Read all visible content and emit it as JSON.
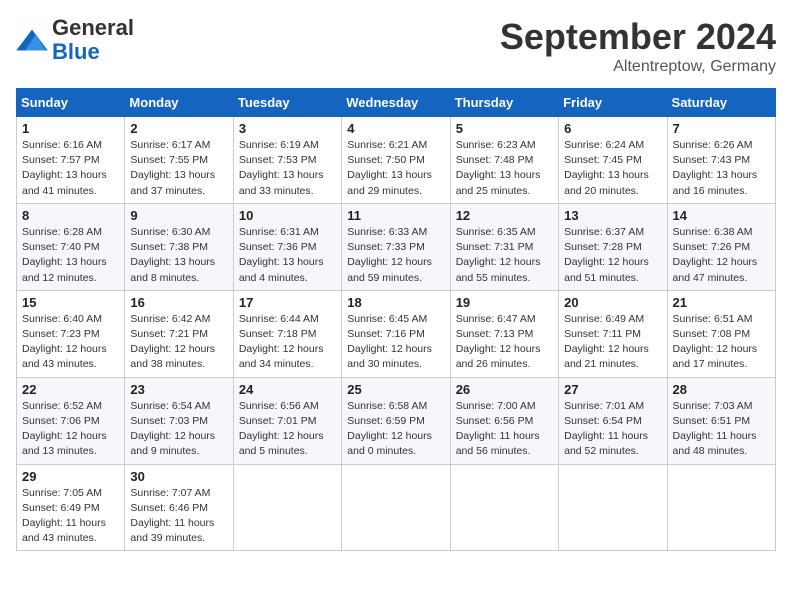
{
  "header": {
    "logo_general": "General",
    "logo_blue": "Blue",
    "month_title": "September 2024",
    "subtitle": "Altentreptow, Germany"
  },
  "days_of_week": [
    "Sunday",
    "Monday",
    "Tuesday",
    "Wednesday",
    "Thursday",
    "Friday",
    "Saturday"
  ],
  "weeks": [
    [
      {
        "day": "1",
        "info": "Sunrise: 6:16 AM\nSunset: 7:57 PM\nDaylight: 13 hours\nand 41 minutes."
      },
      {
        "day": "2",
        "info": "Sunrise: 6:17 AM\nSunset: 7:55 PM\nDaylight: 13 hours\nand 37 minutes."
      },
      {
        "day": "3",
        "info": "Sunrise: 6:19 AM\nSunset: 7:53 PM\nDaylight: 13 hours\nand 33 minutes."
      },
      {
        "day": "4",
        "info": "Sunrise: 6:21 AM\nSunset: 7:50 PM\nDaylight: 13 hours\nand 29 minutes."
      },
      {
        "day": "5",
        "info": "Sunrise: 6:23 AM\nSunset: 7:48 PM\nDaylight: 13 hours\nand 25 minutes."
      },
      {
        "day": "6",
        "info": "Sunrise: 6:24 AM\nSunset: 7:45 PM\nDaylight: 13 hours\nand 20 minutes."
      },
      {
        "day": "7",
        "info": "Sunrise: 6:26 AM\nSunset: 7:43 PM\nDaylight: 13 hours\nand 16 minutes."
      }
    ],
    [
      {
        "day": "8",
        "info": "Sunrise: 6:28 AM\nSunset: 7:40 PM\nDaylight: 13 hours\nand 12 minutes."
      },
      {
        "day": "9",
        "info": "Sunrise: 6:30 AM\nSunset: 7:38 PM\nDaylight: 13 hours\nand 8 minutes."
      },
      {
        "day": "10",
        "info": "Sunrise: 6:31 AM\nSunset: 7:36 PM\nDaylight: 13 hours\nand 4 minutes."
      },
      {
        "day": "11",
        "info": "Sunrise: 6:33 AM\nSunset: 7:33 PM\nDaylight: 12 hours\nand 59 minutes."
      },
      {
        "day": "12",
        "info": "Sunrise: 6:35 AM\nSunset: 7:31 PM\nDaylight: 12 hours\nand 55 minutes."
      },
      {
        "day": "13",
        "info": "Sunrise: 6:37 AM\nSunset: 7:28 PM\nDaylight: 12 hours\nand 51 minutes."
      },
      {
        "day": "14",
        "info": "Sunrise: 6:38 AM\nSunset: 7:26 PM\nDaylight: 12 hours\nand 47 minutes."
      }
    ],
    [
      {
        "day": "15",
        "info": "Sunrise: 6:40 AM\nSunset: 7:23 PM\nDaylight: 12 hours\nand 43 minutes."
      },
      {
        "day": "16",
        "info": "Sunrise: 6:42 AM\nSunset: 7:21 PM\nDaylight: 12 hours\nand 38 minutes."
      },
      {
        "day": "17",
        "info": "Sunrise: 6:44 AM\nSunset: 7:18 PM\nDaylight: 12 hours\nand 34 minutes."
      },
      {
        "day": "18",
        "info": "Sunrise: 6:45 AM\nSunset: 7:16 PM\nDaylight: 12 hours\nand 30 minutes."
      },
      {
        "day": "19",
        "info": "Sunrise: 6:47 AM\nSunset: 7:13 PM\nDaylight: 12 hours\nand 26 minutes."
      },
      {
        "day": "20",
        "info": "Sunrise: 6:49 AM\nSunset: 7:11 PM\nDaylight: 12 hours\nand 21 minutes."
      },
      {
        "day": "21",
        "info": "Sunrise: 6:51 AM\nSunset: 7:08 PM\nDaylight: 12 hours\nand 17 minutes."
      }
    ],
    [
      {
        "day": "22",
        "info": "Sunrise: 6:52 AM\nSunset: 7:06 PM\nDaylight: 12 hours\nand 13 minutes."
      },
      {
        "day": "23",
        "info": "Sunrise: 6:54 AM\nSunset: 7:03 PM\nDaylight: 12 hours\nand 9 minutes."
      },
      {
        "day": "24",
        "info": "Sunrise: 6:56 AM\nSunset: 7:01 PM\nDaylight: 12 hours\nand 5 minutes."
      },
      {
        "day": "25",
        "info": "Sunrise: 6:58 AM\nSunset: 6:59 PM\nDaylight: 12 hours\nand 0 minutes."
      },
      {
        "day": "26",
        "info": "Sunrise: 7:00 AM\nSunset: 6:56 PM\nDaylight: 11 hours\nand 56 minutes."
      },
      {
        "day": "27",
        "info": "Sunrise: 7:01 AM\nSunset: 6:54 PM\nDaylight: 11 hours\nand 52 minutes."
      },
      {
        "day": "28",
        "info": "Sunrise: 7:03 AM\nSunset: 6:51 PM\nDaylight: 11 hours\nand 48 minutes."
      }
    ],
    [
      {
        "day": "29",
        "info": "Sunrise: 7:05 AM\nSunset: 6:49 PM\nDaylight: 11 hours\nand 43 minutes."
      },
      {
        "day": "30",
        "info": "Sunrise: 7:07 AM\nSunset: 6:46 PM\nDaylight: 11 hours\nand 39 minutes."
      },
      {
        "day": "",
        "info": ""
      },
      {
        "day": "",
        "info": ""
      },
      {
        "day": "",
        "info": ""
      },
      {
        "day": "",
        "info": ""
      },
      {
        "day": "",
        "info": ""
      }
    ]
  ]
}
